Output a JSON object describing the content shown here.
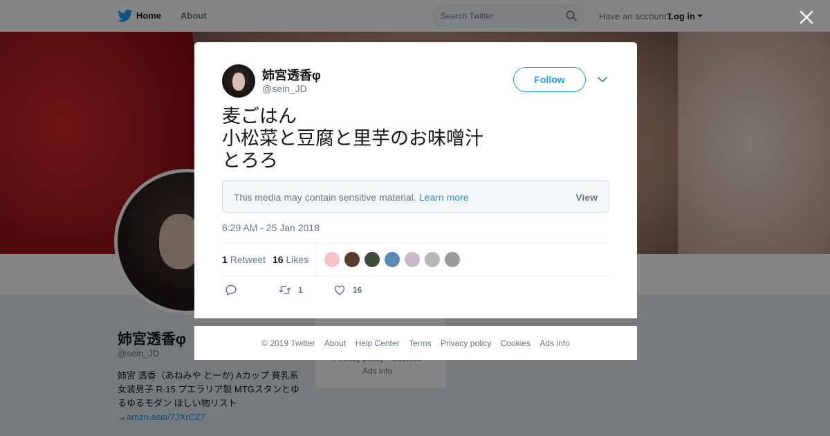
{
  "nav": {
    "home_label": "Home",
    "about_label": "About",
    "search_placeholder": "Search Twitter",
    "account_prompt": "Have an account?",
    "login_label": "Log in"
  },
  "profile": {
    "name": "姉宮透香φ",
    "handle": "@sein_JD",
    "bio": "姉宮 透香（あねみや とーか) Aカップ 貧乳系女装男子 R-15 プエラリア製 MTGスタンとゆるゆるモダン ほしい物リスト→",
    "bio_link": "amzn.asia/7JXrCZ7"
  },
  "side_card": {
    "line1": "Privacy policy · Cookies",
    "line2": "Ads info"
  },
  "tweet": {
    "author_name": "姉宮透香φ",
    "author_handle": "@sein_JD",
    "follow_label": "Follow",
    "text_lines": [
      "麦ごはん",
      "小松菜と豆腐と里芋のお味噌汁",
      "とろろ"
    ],
    "sensitive_notice": "This media may contain sensitive material.",
    "sensitive_learn_more": "Learn more",
    "sensitive_view": "View",
    "timestamp": "6:29 AM - 25 Jan 2018",
    "retweet_count": "1",
    "retweet_label": "Retweet",
    "likes_count": "16",
    "likes_label": "Likes",
    "action_retweet_count": "1",
    "action_like_count": "16"
  },
  "likers": [
    {
      "color": "#f3c4c4"
    },
    {
      "color": "#5b3a2c"
    },
    {
      "color": "#3d4a3a"
    },
    {
      "color": "#5b86b8"
    },
    {
      "color": "#c9b9c6"
    },
    {
      "color": "#b8b8b8"
    },
    {
      "color": "#9a9a9a"
    }
  ],
  "footer": {
    "copyright": "© 2019 Twitter",
    "about": "About",
    "help": "Help Center",
    "terms": "Terms",
    "privacy": "Privacy policy",
    "cookies": "Cookies",
    "ads": "Ads info"
  },
  "colors": {
    "accent": "#1da1f2",
    "link": "#1b95e0",
    "muted": "#657786"
  }
}
